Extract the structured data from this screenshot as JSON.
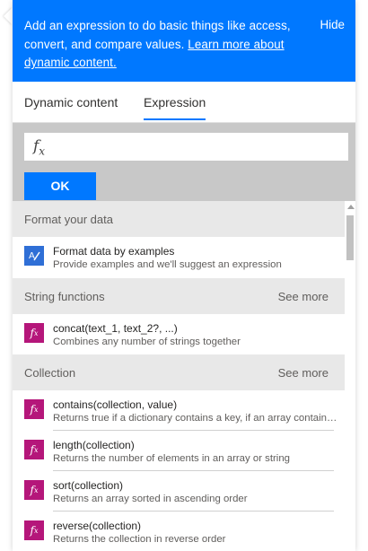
{
  "banner": {
    "text": "Add an expression to do basic things like access, convert, and compare values.",
    "link": "Learn more about dynamic content.",
    "hide_label": "Hide"
  },
  "tabs": {
    "dynamic": "Dynamic content",
    "expression": "Expression",
    "active": "Expression"
  },
  "expression": {
    "value": "",
    "ok_label": "OK"
  },
  "sections": [
    {
      "title": "Format your data",
      "see_more": "",
      "items": [
        {
          "icon": "format-data-icon",
          "name": "Format data by examples",
          "desc": "Provide examples and we'll suggest an expression"
        }
      ]
    },
    {
      "title": "String functions",
      "see_more": "See more",
      "items": [
        {
          "icon": "fx-icon",
          "name": "concat(text_1, text_2?, ...)",
          "desc": "Combines any number of strings together"
        }
      ]
    },
    {
      "title": "Collection",
      "see_more": "See more",
      "items": [
        {
          "icon": "fx-icon",
          "name": "contains(collection, value)",
          "desc": "Returns true if a dictionary contains a key, if an array contains a value, or if a string contains a substring"
        },
        {
          "icon": "fx-icon",
          "name": "length(collection)",
          "desc": "Returns the number of elements in an array or string"
        },
        {
          "icon": "fx-icon",
          "name": "sort(collection)",
          "desc": "Returns an array sorted in ascending order"
        },
        {
          "icon": "fx-icon",
          "name": "reverse(collection)",
          "desc": "Returns the collection in reverse order"
        }
      ]
    }
  ],
  "colors": {
    "accent": "#0078ff",
    "fx_icon": "#b5167a",
    "format_icon": "#2f6fd6",
    "section_bg": "#e8e8e8",
    "input_area_bg": "#c8c8c8"
  }
}
